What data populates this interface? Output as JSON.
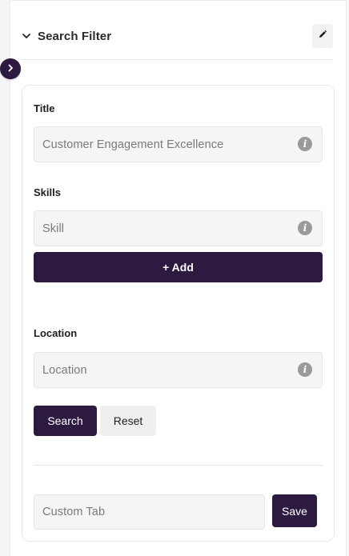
{
  "header": {
    "title": "Search Filter",
    "collapse_icon": "chevron-down-icon",
    "edit_icon": "pencil-icon"
  },
  "sidebar_toggle": {
    "icon": "chevron-right-icon"
  },
  "form": {
    "title": {
      "label": "Title",
      "value": "Customer Engagement Excellence",
      "info_icon": "info-icon"
    },
    "skills": {
      "label": "Skills",
      "placeholder": "Skill",
      "info_icon": "info-icon",
      "add_label": "+ Add"
    },
    "location": {
      "label": "Location",
      "placeholder": "Location",
      "info_icon": "info-icon"
    },
    "search_label": "Search",
    "reset_label": "Reset",
    "custom_tab": {
      "placeholder": "Custom Tab",
      "save_label": "Save"
    }
  },
  "colors": {
    "primary": "#2d1a40",
    "input_bg": "#f5f5f5",
    "secondary_button_bg": "#efefef"
  }
}
